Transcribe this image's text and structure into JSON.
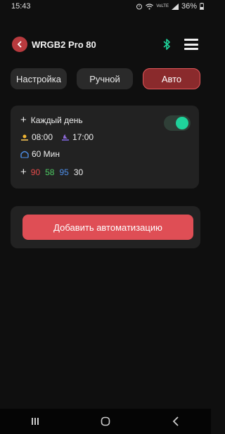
{
  "status": {
    "time": "15:43",
    "battery": "36%",
    "volte": "VoLTE"
  },
  "header": {
    "title": "WRGB2 Pro 80"
  },
  "tabs": [
    {
      "label": "Настройка",
      "active": false
    },
    {
      "label": "Ручной",
      "active": false
    },
    {
      "label": "Авто",
      "active": true
    }
  ],
  "automation": {
    "schedule_label": "Каждый день",
    "start_time": "08:00",
    "end_time": "17:00",
    "duration": "60 Мин",
    "red": "90",
    "green": "58",
    "blue": "95",
    "white": "30",
    "enabled": true
  },
  "add_button_label": "Добавить автоматизацию",
  "colors": {
    "accent": "#df4e55",
    "toggle_on": "#1fd39b",
    "red": "#e34a4a",
    "green": "#4ecb64",
    "blue": "#4d8ee8"
  }
}
